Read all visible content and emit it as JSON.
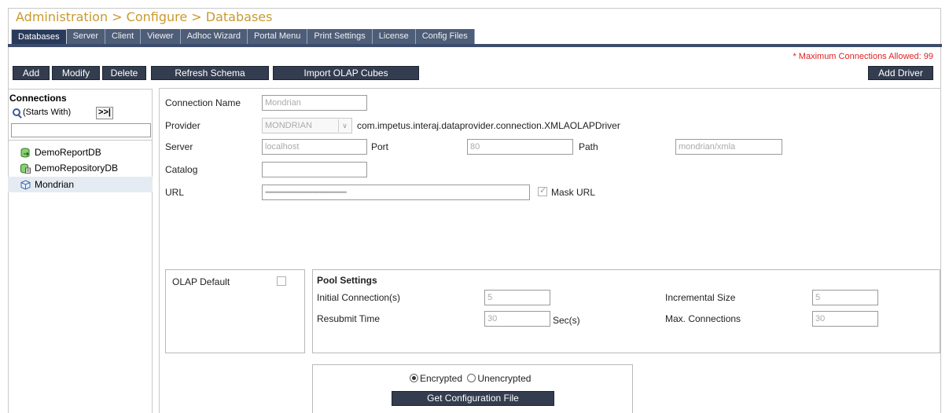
{
  "header": {
    "title": "Administration > Configure > Databases"
  },
  "tabs": [
    {
      "label": "Databases",
      "active": true
    },
    {
      "label": "Server"
    },
    {
      "label": "Client"
    },
    {
      "label": "Viewer"
    },
    {
      "label": "Adhoc Wizard"
    },
    {
      "label": "Portal Menu"
    },
    {
      "label": "Print Settings"
    },
    {
      "label": "License"
    },
    {
      "label": "Config Files"
    }
  ],
  "notice": "* Maximum Connections Allowed: 99",
  "toolbar": {
    "add": "Add",
    "modify": "Modify",
    "delete": "Delete",
    "refresh_schema": "Refresh Schema",
    "import_olap": "Import OLAP Cubes",
    "add_driver": "Add Driver"
  },
  "connections": {
    "title": "Connections",
    "search_label": "(Starts With)",
    "go_label": ">>|",
    "search_value": "",
    "items": [
      {
        "label": "DemoReportDB",
        "icon": "database-arrow-icon"
      },
      {
        "label": "DemoRepositoryDB",
        "icon": "database-doc-icon"
      },
      {
        "label": "Mondrian",
        "icon": "cube-icon",
        "selected": true
      }
    ]
  },
  "form": {
    "connection_name_label": "Connection Name",
    "connection_name_value": "Mondrian",
    "provider_label": "Provider",
    "provider_value": "MONDRIAN",
    "provider_driver": "com.impetus.interaj.dataprovider.connection.XMLAOLAPDriver",
    "server_label": "Server",
    "server_value": "localhost",
    "port_label": "Port",
    "port_value": "80",
    "path_label": "Path",
    "path_value": "mondrian/xmla",
    "catalog_label": "Catalog",
    "catalog_value": "",
    "url_label": "URL",
    "url_value": "••••••••••••••••••••••••••••••••••••••••••••••••",
    "mask_url_label": "Mask URL",
    "olap_default_label": "OLAP Default"
  },
  "pool": {
    "title": "Pool Settings",
    "initial_label": "Initial Connection(s)",
    "initial_value": "5",
    "incremental_label": "Incremental Size",
    "incremental_value": "5",
    "resubmit_label": "Resubmit Time",
    "resubmit_value": "30",
    "resubmit_unit": "Sec(s)",
    "max_label": "Max. Connections",
    "max_value": "30"
  },
  "config": {
    "encrypted_label": "Encrypted",
    "unencrypted_label": "Unencrypted",
    "get_config_label": "Get Configuration File"
  },
  "colors": {
    "title": "#c99a2e",
    "tab_bg": "#4e5d78",
    "button_bg": "#333d4f",
    "notice": "#e02020",
    "selected_row": "#e5ebf2"
  }
}
